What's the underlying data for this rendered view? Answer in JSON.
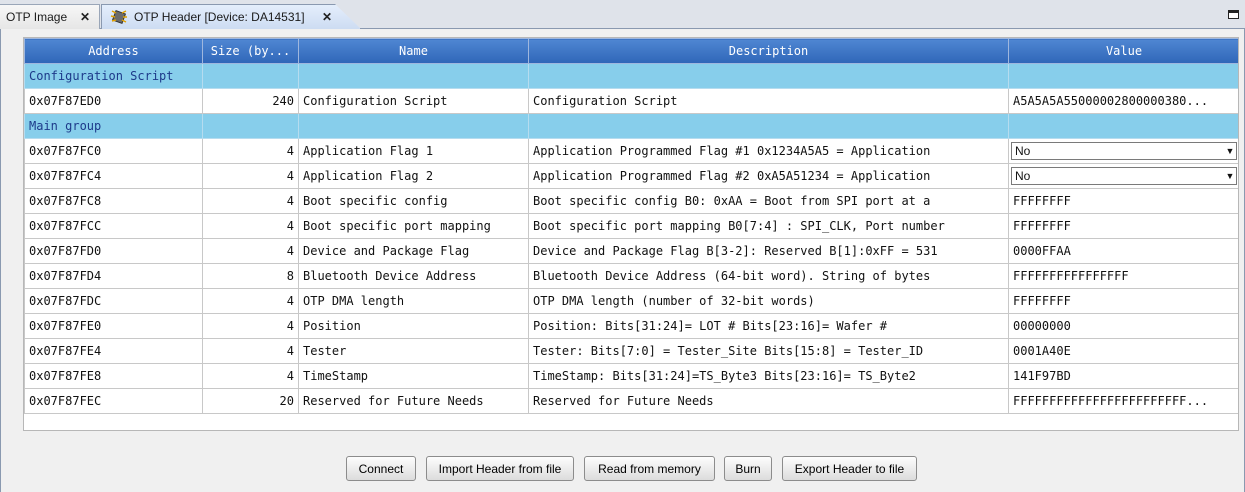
{
  "tabs": [
    {
      "label": "OTP Image"
    },
    {
      "label": "OTP Header [Device: DA14531]"
    }
  ],
  "table": {
    "columns": [
      "Address",
      "Size (by...",
      "Name",
      "Description",
      "Value"
    ],
    "rows": [
      {
        "type": "group",
        "label": "Configuration Script"
      },
      {
        "type": "row",
        "address": "0x07F87ED0",
        "size": "240",
        "name": "Configuration Script",
        "description": "Configuration Script",
        "value": "A5A5A5A55000002800000380..."
      },
      {
        "type": "group",
        "label": "Main group"
      },
      {
        "type": "select",
        "address": "0x07F87FC0",
        "size": "4",
        "name": "Application Flag 1",
        "description": "Application Programmed Flag #1 0x1234A5A5 = Application",
        "value": "No"
      },
      {
        "type": "select",
        "address": "0x07F87FC4",
        "size": "4",
        "name": "Application Flag 2",
        "description": "Application Programmed Flag #2 0xA5A51234 = Application",
        "value": "No"
      },
      {
        "type": "row",
        "address": "0x07F87FC8",
        "size": "4",
        "name": "Boot specific config",
        "description": "Boot specific config B0: 0xAA = Boot from SPI port at a",
        "value": "FFFFFFFF"
      },
      {
        "type": "row",
        "address": "0x07F87FCC",
        "size": "4",
        "name": "Boot specific port mapping",
        "description": "Boot specific port mapping B0[7:4] : SPI_CLK, Port number",
        "value": "FFFFFFFF"
      },
      {
        "type": "row",
        "address": "0x07F87FD0",
        "size": "4",
        "name": "Device and Package Flag",
        "description": "Device and Package Flag B[3-2]: Reserved B[1]:0xFF = 531",
        "value": "0000FFAA"
      },
      {
        "type": "row",
        "address": "0x07F87FD4",
        "size": "8",
        "name": "Bluetooth Device Address",
        "description": "Bluetooth Device Address (64-bit word). String of bytes",
        "value": "FFFFFFFFFFFFFFFF"
      },
      {
        "type": "row",
        "address": "0x07F87FDC",
        "size": "4",
        "name": "OTP DMA length",
        "description": "OTP DMA length (number of 32-bit words)",
        "value": "FFFFFFFF"
      },
      {
        "type": "row",
        "address": "0x07F87FE0",
        "size": "4",
        "name": "Position",
        "description": "Position: Bits[31:24]= LOT # Bits[23:16]= Wafer #",
        "value": "00000000"
      },
      {
        "type": "row",
        "address": "0x07F87FE4",
        "size": "4",
        "name": "Tester",
        "description": "Tester: Bits[7:0] = Tester_Site Bits[15:8] = Tester_ID",
        "value": "0001A40E"
      },
      {
        "type": "row",
        "address": "0x07F87FE8",
        "size": "4",
        "name": "TimeStamp",
        "description": "TimeStamp: Bits[31:24]=TS_Byte3 Bits[23:16]= TS_Byte2",
        "value": "141F97BD"
      },
      {
        "type": "row",
        "address": "0x07F87FEC",
        "size": "20",
        "name": "Reserved for Future Needs",
        "description": "Reserved for Future Needs",
        "value": "FFFFFFFFFFFFFFFFFFFFFFFF..."
      }
    ]
  },
  "buttons": {
    "connect": "Connect",
    "import": "Import Header from file",
    "read": "Read from memory",
    "burn": "Burn",
    "export": "Export Header to file"
  },
  "icons": {
    "close": "close-icon",
    "chip": "chip-icon",
    "maximize": "maximize-icon",
    "dropdown": "chevron-down-icon"
  },
  "colors": {
    "header_blue": "#2f66b8",
    "group_row": "#87ceeb",
    "group_text": "#1d3a8a"
  }
}
